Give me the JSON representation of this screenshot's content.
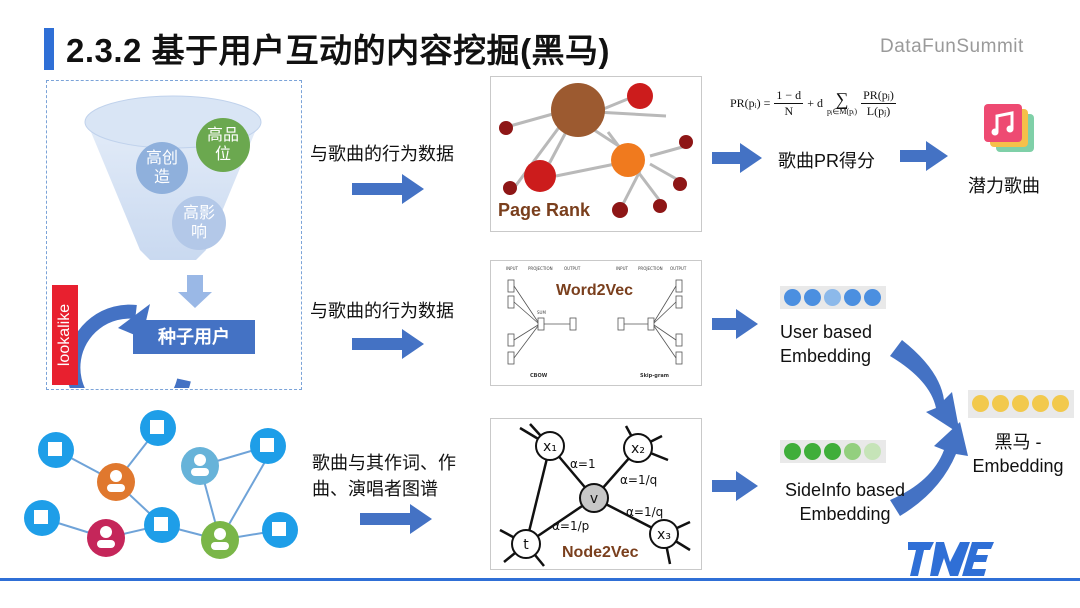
{
  "header": {
    "title": "2.3.2 基于用户互动的内容挖掘(黑马)",
    "brand": "DataFunSummit"
  },
  "funnel": {
    "bubble_create": "高创\n造",
    "bubble_quality": "高品\n位",
    "bubble_influence": "高影\n响",
    "seed_label": "种子用户",
    "lookalike_label": "lookalike"
  },
  "rows": {
    "row1_input": "与歌曲的行为数据",
    "row2_input": "与歌曲的行为数据",
    "row3_input": "歌曲与其作词、作曲、演唱者图谱"
  },
  "pagerank": {
    "title": "Page Rank",
    "formula_lhs": "PR(pᵢ) =",
    "formula_frac_num": "1 − d",
    "formula_frac_den": "N",
    "formula_mid": "+ d",
    "formula_sum_sub": "pⱼ∈M(pᵢ)",
    "formula_rhs_num": "PR(pⱼ)",
    "formula_rhs_den": "L(pⱼ)",
    "score_label": "歌曲PR得分",
    "result_label": "潜力歌曲"
  },
  "word2vec": {
    "title": "Word2Vec",
    "input_l": "INPUT",
    "proj_l": "PROJECTION",
    "output_l": "OUTPUT",
    "input_r": "INPUT",
    "proj_r": "PROJECTION",
    "output_r": "OUTPUT",
    "sum": "SUM",
    "cbow": "CBOW",
    "skipgram": "Skip-gram",
    "embedding_label": "User based\nEmbedding"
  },
  "node2vec": {
    "title": "Node2Vec",
    "n_x1": "x₁",
    "n_x2": "x₂",
    "n_x3": "x₃",
    "n_v": "v",
    "n_t": "t",
    "e_x1v": "α=1",
    "e_x2v": "α=1/q",
    "e_x3v": "α=1/q",
    "e_tv": "α=1/p",
    "embedding_label": "SideInfo based\nEmbedding"
  },
  "final": {
    "label": "黑马 -\nEmbedding"
  },
  "colors": {
    "accent_blue": "#2f6fd6",
    "arrow_blue": "#4472c4",
    "red": "#e8202f",
    "emb_user": "#5b9bd5",
    "emb_side": "#5bb54a",
    "emb_final": "#f2c94c"
  }
}
